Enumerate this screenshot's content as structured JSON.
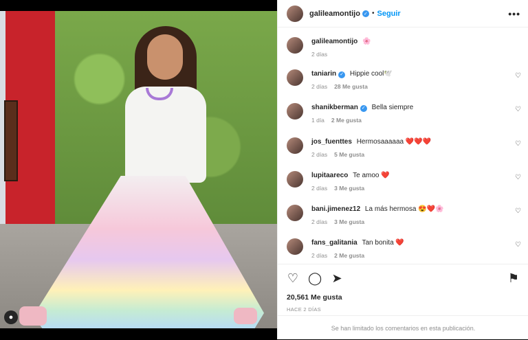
{
  "header": {
    "username": "galileamontijo",
    "separator": "•",
    "follow_label": "Seguir",
    "more_label": "•••"
  },
  "caption": {
    "username": "galileamontijo",
    "text": "🌸",
    "time": "2 días"
  },
  "comments": [
    {
      "username": "taniarin",
      "verified": true,
      "text": "Hippie cool🕊️",
      "time": "2 días",
      "likes": "28 Me gusta"
    },
    {
      "username": "shanikberman",
      "verified": true,
      "text": "Bella siempre",
      "time": "1 día",
      "likes": "2 Me gusta"
    },
    {
      "username": "jos_fuenttes",
      "verified": false,
      "text": "Hermosaaaaaa ❤️❤️❤️",
      "time": "2 días",
      "likes": "5 Me gusta"
    },
    {
      "username": "lupitaareco",
      "verified": false,
      "text": "Te amoo ❤️",
      "time": "2 días",
      "likes": "3 Me gusta"
    },
    {
      "username": "bani.jimenez12",
      "verified": false,
      "text": "La más hermosa 😍❤️🌸",
      "time": "2 días",
      "likes": "3 Me gusta"
    },
    {
      "username": "fans_galitania",
      "verified": false,
      "text": "Tan bonita ❤️",
      "time": "2 días",
      "likes": "2 Me gusta"
    }
  ],
  "actions": {
    "like_icon": "♡",
    "comment_icon": "◯",
    "share_icon": "➤",
    "save_icon": "⚑"
  },
  "likes_count": "20,561 Me gusta",
  "date": "HACE 2 DÍAS",
  "comments_limited": "Se han limitado los comentarios en esta publicación.",
  "colors": {
    "accent": "#0095f6",
    "verified": "#3897f0",
    "muted": "#8e8e8e"
  }
}
